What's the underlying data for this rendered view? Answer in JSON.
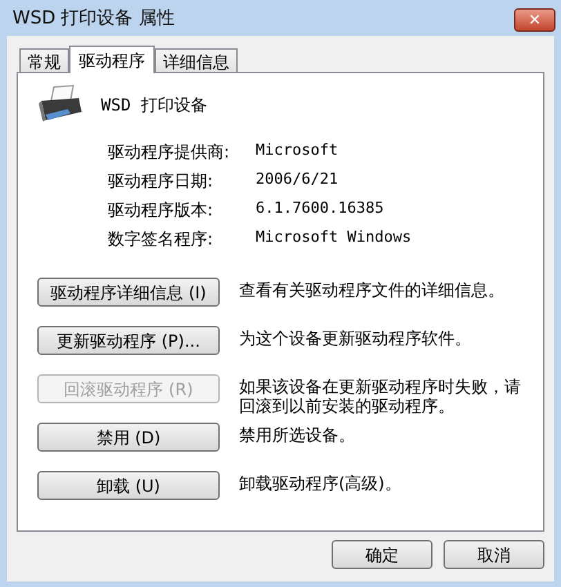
{
  "window": {
    "title": "WSD 打印设备 属性",
    "close": "✕"
  },
  "tabs": [
    {
      "label": "常规",
      "selected": false
    },
    {
      "label": "驱动程序",
      "selected": true
    },
    {
      "label": "详细信息",
      "selected": false
    }
  ],
  "device": {
    "name": "WSD 打印设备"
  },
  "properties": [
    {
      "label": "驱动程序提供商:",
      "value": "Microsoft"
    },
    {
      "label": "驱动程序日期:",
      "value": "2006/6/21"
    },
    {
      "label": "驱动程序版本:",
      "value": "6.1.7600.16385"
    },
    {
      "label": "数字签名程序:",
      "value": "Microsoft Windows"
    }
  ],
  "actions": [
    {
      "button": "驱动程序详细信息 (I)",
      "description": "查看有关驱动程序文件的详细信息。",
      "disabled": false
    },
    {
      "button": "更新驱动程序 (P)...",
      "description": "为这个设备更新驱动程序软件。",
      "disabled": false
    },
    {
      "button": "回滚驱动程序 (R)",
      "description": "如果该设备在更新驱动程序时失败，请回滚到以前安装的驱动程序。",
      "disabled": true
    },
    {
      "button": "禁用 (D)",
      "description": "禁用所选设备。",
      "disabled": false
    },
    {
      "button": "卸载 (U)",
      "description": "卸载驱动程序(高级)。",
      "disabled": false
    }
  ],
  "buttons": [
    "确定",
    "取消"
  ]
}
